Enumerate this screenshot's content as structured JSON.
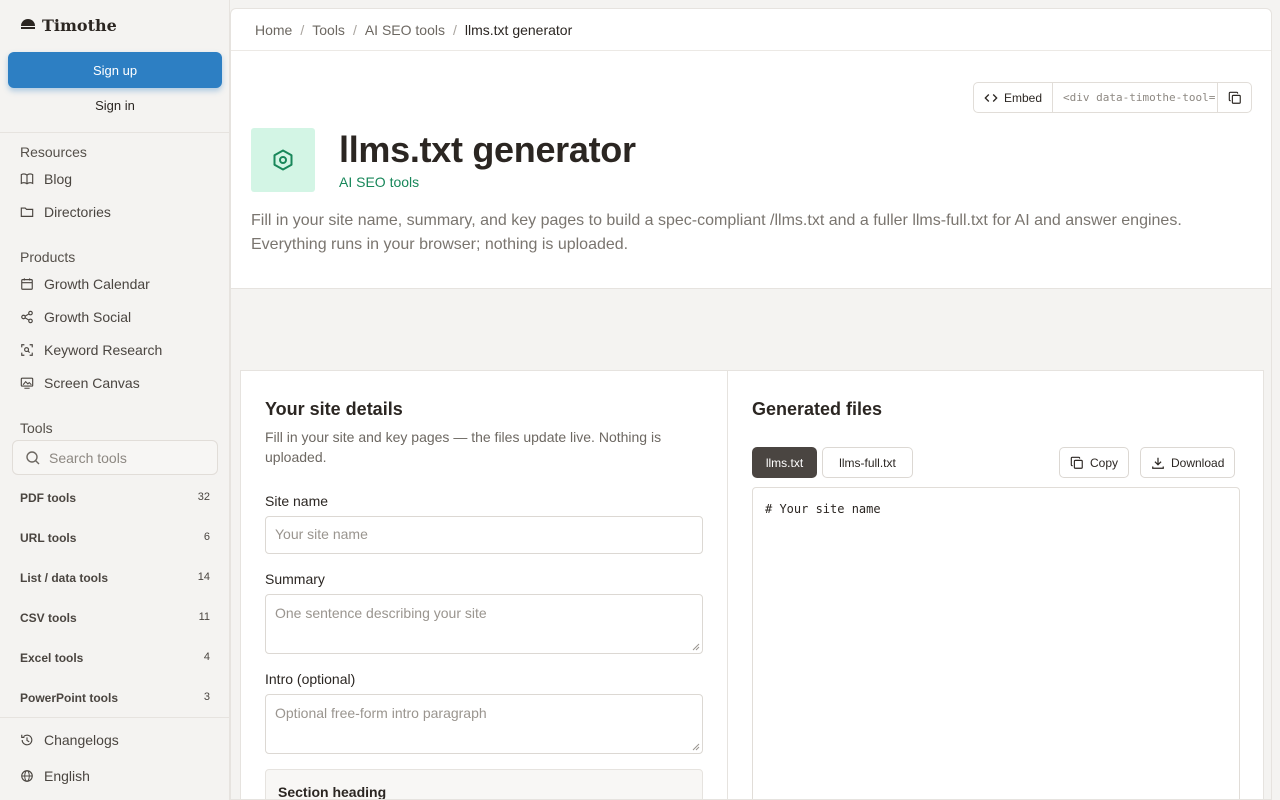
{
  "sidebar": {
    "brand": "Timothe",
    "signup": "Sign up",
    "signin": "Sign in",
    "resources_title": "Resources",
    "resources": [
      {
        "label": "Blog",
        "icon": "book-icon"
      },
      {
        "label": "Directories",
        "icon": "folder-icon"
      }
    ],
    "products_title": "Products",
    "products": [
      {
        "label": "Growth Calendar",
        "icon": "calendar-icon"
      },
      {
        "label": "Growth Social",
        "icon": "share-icon"
      },
      {
        "label": "Keyword Research",
        "icon": "scan-search-icon"
      },
      {
        "label": "Screen Canvas",
        "icon": "screen-image-icon"
      }
    ],
    "tools_title": "Tools",
    "search_placeholder": "Search tools",
    "categories": [
      {
        "label": "PDF tools",
        "count": "32"
      },
      {
        "label": "URL tools",
        "count": "6"
      },
      {
        "label": "List / data tools",
        "count": "14"
      },
      {
        "label": "CSV tools",
        "count": "11"
      },
      {
        "label": "Excel tools",
        "count": "4"
      },
      {
        "label": "PowerPoint tools",
        "count": "3"
      }
    ],
    "footer": [
      {
        "label": "Changelogs",
        "icon": "history-icon"
      },
      {
        "label": "English",
        "icon": "globe-icon"
      }
    ]
  },
  "breadcrumb": [
    "Home",
    "Tools",
    "AI SEO tools",
    "llms.txt generator"
  ],
  "embed": {
    "label": "Embed",
    "code": "<div data-timothe-tool=\"llms-txt-generator\"></div>"
  },
  "hero": {
    "title": "llms.txt generator",
    "category": "AI SEO tools",
    "description": "Fill in your site name, summary, and key pages to build a spec-compliant /llms.txt and a fuller llms-full.txt for AI and answer engines. Everything runs in your browser; nothing is uploaded."
  },
  "form": {
    "title": "Your site details",
    "description": "Fill in your site and key pages — the files update live. Nothing is uploaded.",
    "site_name_label": "Site name",
    "site_name_placeholder": "Your site name",
    "summary_label": "Summary",
    "summary_placeholder": "One sentence describing your site",
    "intro_label": "Intro (optional)",
    "intro_placeholder": "Optional free-form intro paragraph",
    "section_heading": "Section heading"
  },
  "output": {
    "title": "Generated files",
    "tabs": [
      "llms.txt",
      "llms-full.txt"
    ],
    "active_tab": "llms.txt",
    "copy_label": "Copy",
    "download_label": "Download",
    "content": "# Your site name"
  },
  "colors": {
    "accent": "#2d7fc3",
    "brand_green": "#18875a",
    "icon_bg": "#d3f5e5",
    "active_tab_bg": "#4a4541"
  }
}
